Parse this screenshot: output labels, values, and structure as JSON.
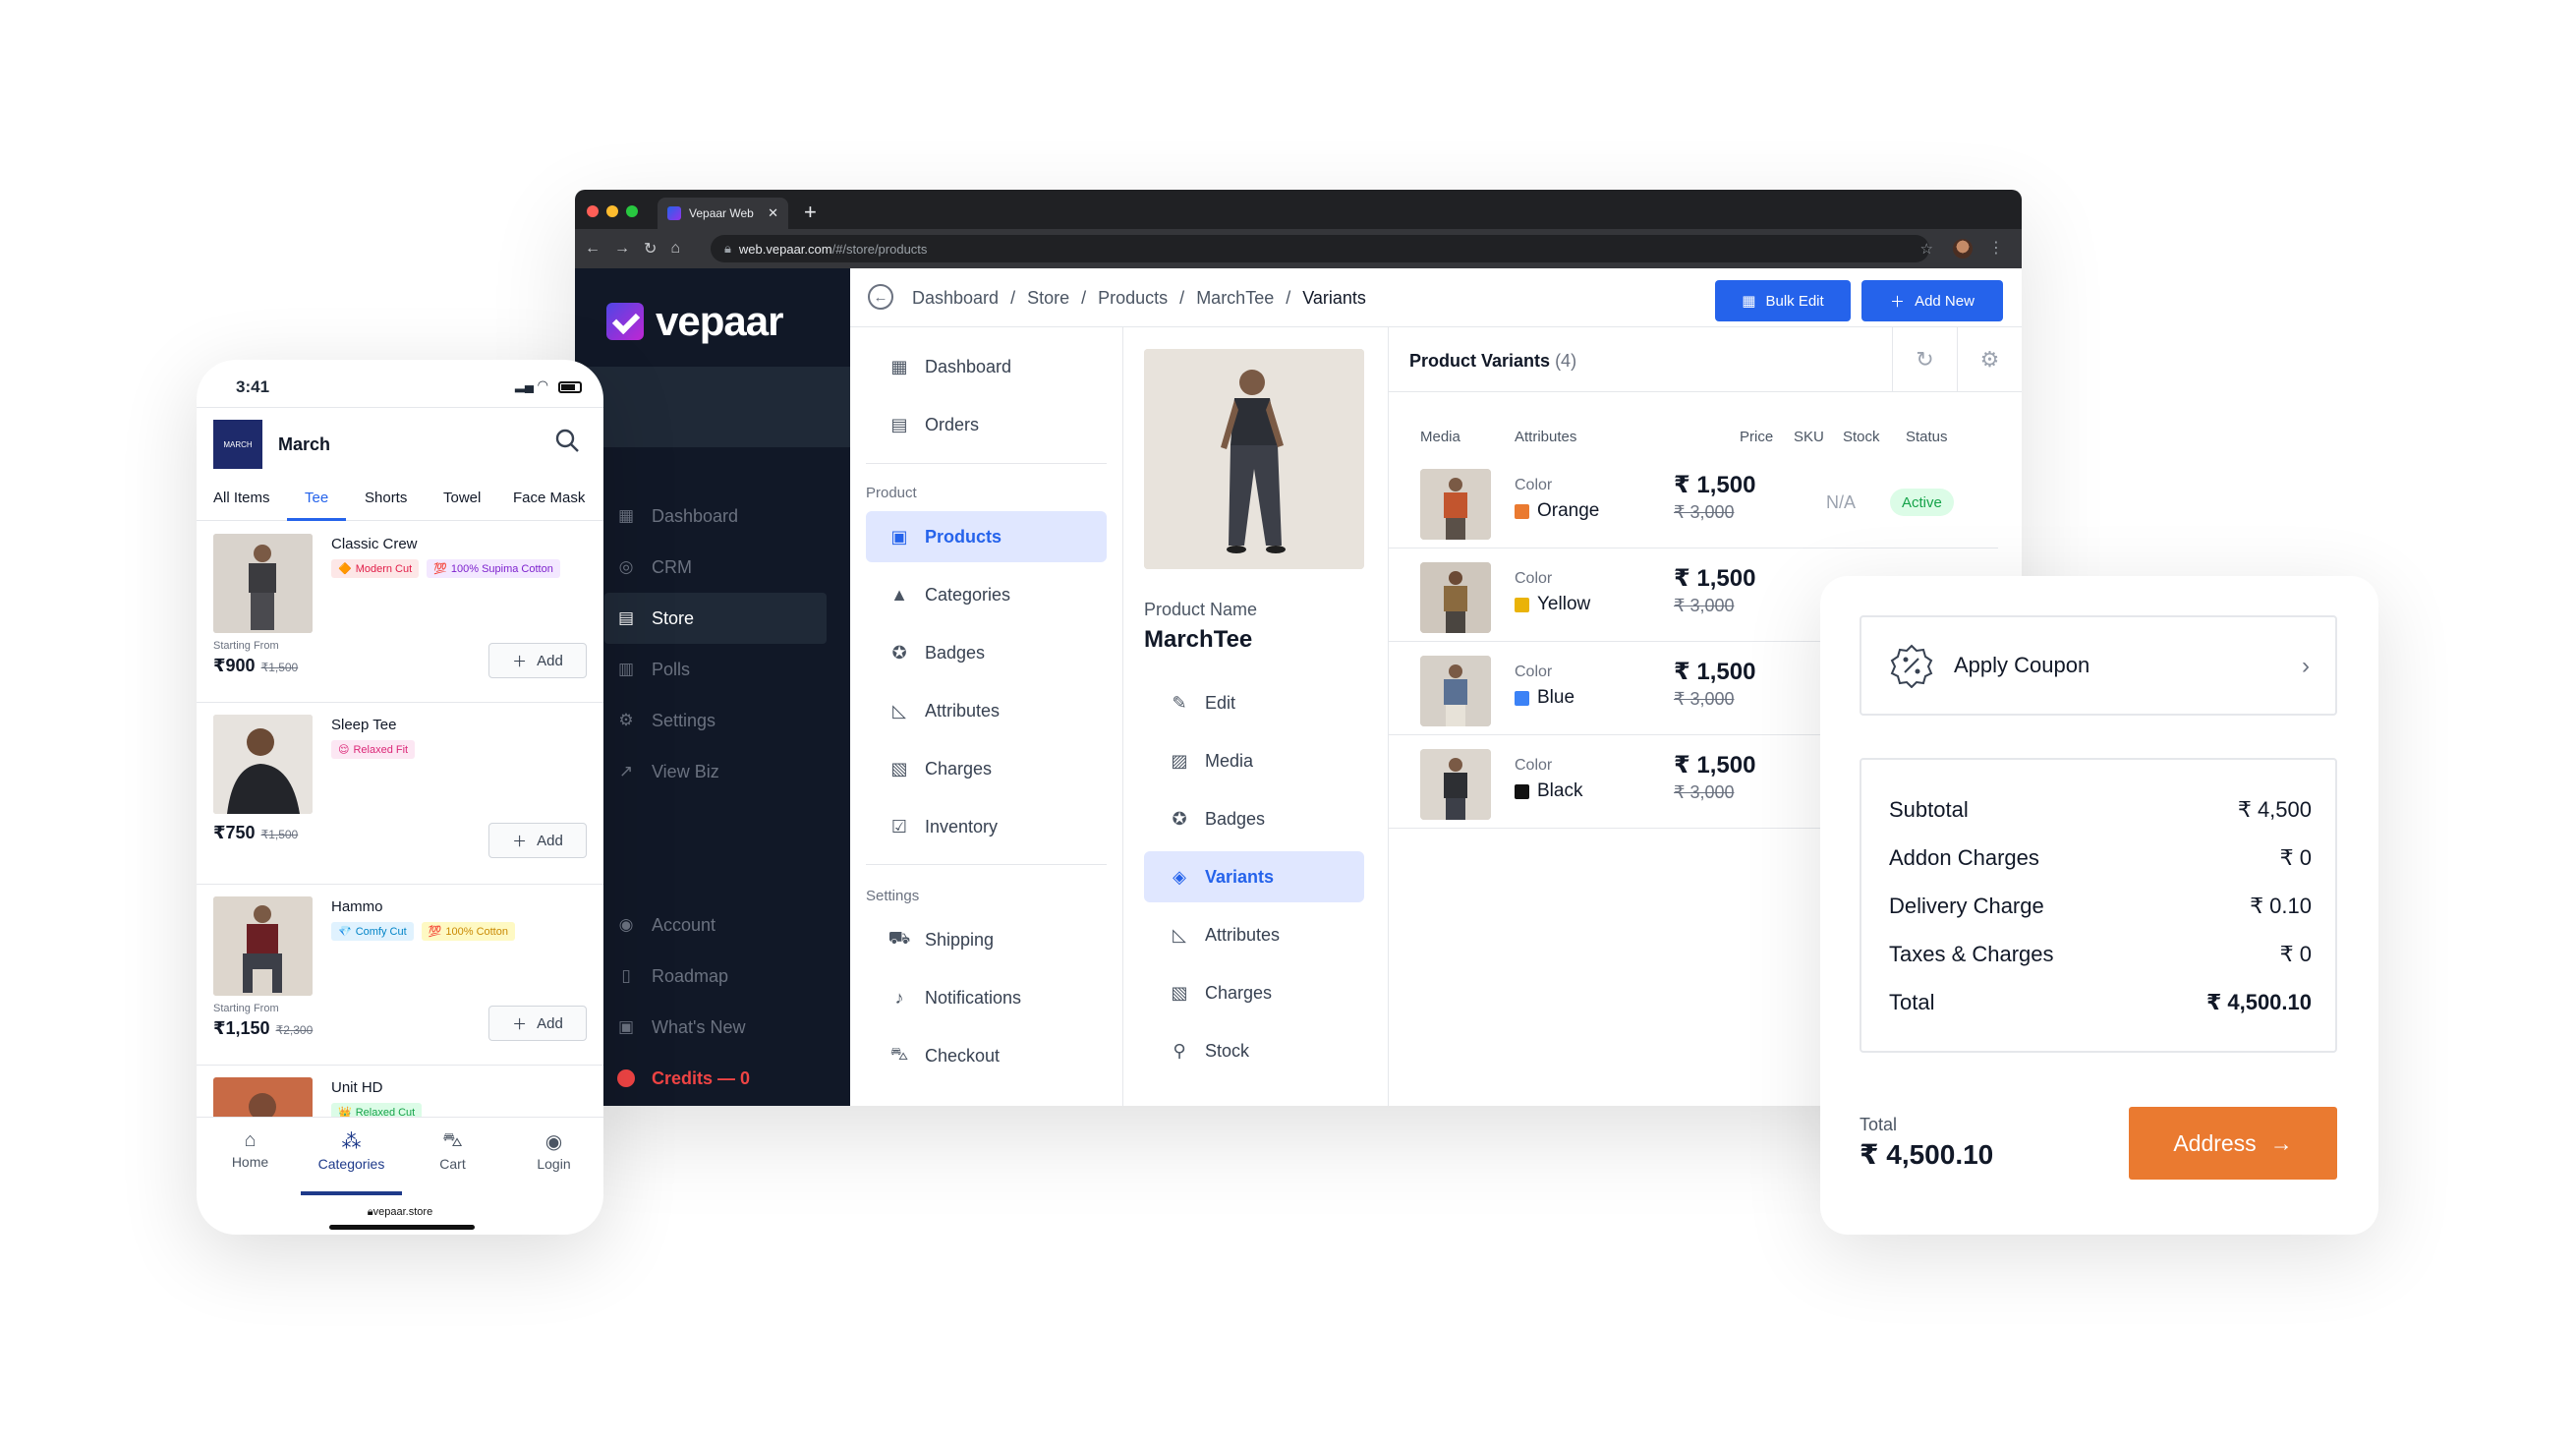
{
  "browser": {
    "tab_title": "Vepaar Web",
    "tab_close": "✕",
    "new_tab": "+",
    "url_host": "web.vepaar.com",
    "url_path": "/#/store/products"
  },
  "sidebar": {
    "logo": "vepaar",
    "items": [
      {
        "label": "Dashboard",
        "icon": "grid-icon"
      },
      {
        "label": "CRM",
        "icon": "crm-icon"
      },
      {
        "label": "Store",
        "icon": "store-icon"
      },
      {
        "label": "Polls",
        "icon": "polls-icon"
      },
      {
        "label": "Settings",
        "icon": "gear-icon"
      },
      {
        "label": "View Biz",
        "icon": "external-link-icon"
      }
    ],
    "bottom_items": [
      {
        "label": "Account",
        "icon": "user-circle-icon"
      },
      {
        "label": "Roadmap",
        "icon": "map-icon"
      },
      {
        "label": "What's New",
        "icon": "gift-icon"
      },
      {
        "label": "Credits — 0",
        "icon": "coin-icon"
      }
    ]
  },
  "topbar": {
    "breadcrumb": [
      "Dashboard",
      "/",
      "Store",
      "/",
      "Products",
      "/",
      "MarchTee",
      "/",
      "Variants"
    ],
    "bulk_edit": "Bulk Edit",
    "add_new": "Add New"
  },
  "menu": {
    "items": [
      {
        "label": "Dashboard",
        "icon": "grid-icon"
      },
      {
        "label": "Orders",
        "icon": "list-icon"
      }
    ],
    "product_section": "Product",
    "product_items": [
      {
        "label": "Products",
        "icon": "box-icon"
      },
      {
        "label": "Categories",
        "icon": "shapes-icon"
      },
      {
        "label": "Badges",
        "icon": "badge-icon"
      },
      {
        "label": "Attributes",
        "icon": "ruler-icon"
      },
      {
        "label": "Charges",
        "icon": "money-icon"
      },
      {
        "label": "Inventory",
        "icon": "clipboard-icon"
      }
    ],
    "settings_section": "Settings",
    "settings_items": [
      {
        "label": "Shipping",
        "icon": "truck-icon"
      },
      {
        "label": "Notifications",
        "icon": "bell-icon"
      },
      {
        "label": "Checkout",
        "icon": "cart-icon"
      }
    ]
  },
  "product": {
    "name_label": "Product Name",
    "name": "MarchTee",
    "actions": [
      {
        "label": "Edit",
        "icon": "pencil-icon"
      },
      {
        "label": "Media",
        "icon": "image-icon"
      },
      {
        "label": "Badges",
        "icon": "badge-icon"
      },
      {
        "label": "Variants",
        "icon": "variants-icon"
      },
      {
        "label": "Attributes",
        "icon": "ruler-icon"
      },
      {
        "label": "Charges",
        "icon": "money-icon"
      },
      {
        "label": "Stock",
        "icon": "stock-icon"
      }
    ]
  },
  "variants": {
    "title": "Product Variants",
    "count": "(4)",
    "columns": [
      "Media",
      "Attributes",
      "Price",
      "SKU",
      "Stock",
      "Status"
    ],
    "rows": [
      {
        "attr_label": "Color",
        "color": "Orange",
        "swatch": "#ea7a30",
        "price": "₹ 1,500",
        "old_price": "₹ 3,000",
        "sku": "N/A",
        "status": "Active",
        "shirt": "#c2552e"
      },
      {
        "attr_label": "Color",
        "color": "Yellow",
        "swatch": "#eab308",
        "price": "₹ 1,500",
        "old_price": "₹ 3,000",
        "shirt": "#8a6a3f"
      },
      {
        "attr_label": "Color",
        "color": "Blue",
        "swatch": "#3b82f6",
        "price": "₹ 1,500",
        "old_price": "₹ 3,000",
        "shirt": "#5a7194"
      },
      {
        "attr_label": "Color",
        "color": "Black",
        "swatch": "#111111",
        "price": "₹ 1,500",
        "old_price": "₹ 3,000",
        "shirt": "#2d2f33"
      }
    ]
  },
  "phone": {
    "time": "3:41",
    "store_logo": "MARCH",
    "store_name": "March",
    "tabs": [
      "All Items",
      "Tee",
      "Shorts",
      "Towel",
      "Face Mask"
    ],
    "products": [
      {
        "title": "Classic Crew",
        "from": "Starting From",
        "price": "₹900",
        "old": "₹1,500",
        "badges": [
          {
            "text": "Modern Cut",
            "icon": "🔶",
            "bg": "#fde7e7",
            "fg": "#e11d48"
          },
          {
            "text": "100% Supima Cotton",
            "icon": "💯",
            "bg": "#f3e8ff",
            "fg": "#7e22ce"
          }
        ],
        "add": "Add",
        "shirt": "#3b3b3f"
      },
      {
        "title": "Sleep Tee",
        "from": "",
        "price": "₹750",
        "old": "₹1,500",
        "badges": [
          {
            "text": "Relaxed Fit",
            "icon": "😌",
            "bg": "#fce7f3",
            "fg": "#db2777"
          }
        ],
        "add": "Add",
        "shirt": "#23252a"
      },
      {
        "title": "Hammo",
        "from": "Starting From",
        "price": "₹1,150",
        "old": "₹2,300",
        "badges": [
          {
            "text": "Comfy Cut",
            "icon": "💎",
            "bg": "#e0f2fe",
            "fg": "#0284c7"
          },
          {
            "text": "100% Cotton",
            "icon": "💯",
            "bg": "#fef9c3",
            "fg": "#ca8a04"
          }
        ],
        "add": "Add",
        "shirt": "#6b1f24"
      },
      {
        "title": "Unit HD",
        "from": "",
        "price": "",
        "old": "",
        "badges": [
          {
            "text": "Relaxed Cut",
            "icon": "👑",
            "bg": "#dcfce7",
            "fg": "#16a34a"
          }
        ],
        "add": "",
        "shirt": "#b5552f"
      }
    ],
    "bottom_nav": [
      {
        "label": "Home",
        "icon": "home-icon"
      },
      {
        "label": "Categories",
        "icon": "categories-icon"
      },
      {
        "label": "Cart",
        "icon": "cart-icon"
      },
      {
        "label": "Login",
        "icon": "user-icon"
      }
    ],
    "url": "vepaar.store"
  },
  "checkout": {
    "coupon": "Apply Coupon",
    "rows": [
      {
        "k": "Subtotal",
        "v": "₹ 4,500"
      },
      {
        "k": "Addon Charges",
        "v": "₹ 0"
      },
      {
        "k": "Delivery Charge",
        "v": "₹ 0.10"
      },
      {
        "k": "Taxes & Charges",
        "v": "₹ 0"
      },
      {
        "k": "Total",
        "v": "₹ 4,500.10"
      }
    ],
    "total_label": "Total",
    "total_value": "₹ 4,500.10",
    "address_button": "Address"
  }
}
